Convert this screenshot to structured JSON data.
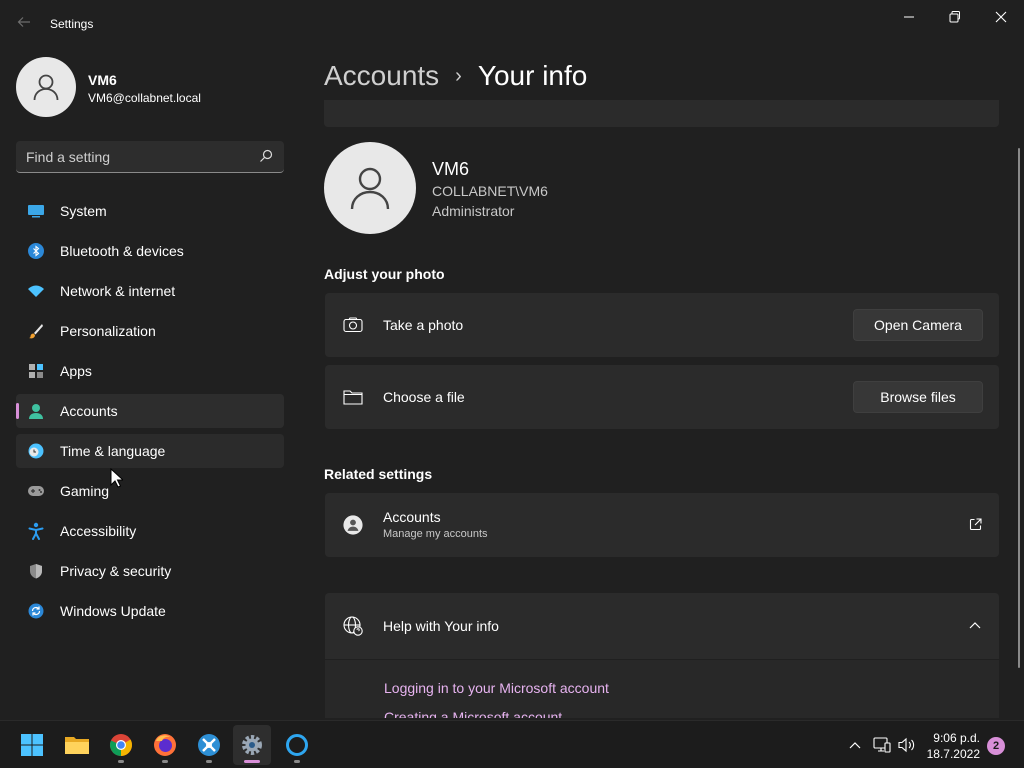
{
  "window": {
    "title": "Settings",
    "accent": "#d88fd8"
  },
  "user": {
    "name": "VM6",
    "email": "VM6@collabnet.local"
  },
  "search": {
    "placeholder": "Find a setting"
  },
  "sidebar": {
    "items": [
      {
        "label": "System",
        "icon": "system-icon"
      },
      {
        "label": "Bluetooth & devices",
        "icon": "bluetooth-icon"
      },
      {
        "label": "Network & internet",
        "icon": "wifi-icon"
      },
      {
        "label": "Personalization",
        "icon": "brush-icon"
      },
      {
        "label": "Apps",
        "icon": "apps-icon"
      },
      {
        "label": "Accounts",
        "icon": "accounts-icon",
        "selected": true
      },
      {
        "label": "Time & language",
        "icon": "time-language-icon"
      },
      {
        "label": "Gaming",
        "icon": "gamepad-icon"
      },
      {
        "label": "Accessibility",
        "icon": "accessibility-icon"
      },
      {
        "label": "Privacy & security",
        "icon": "shield-icon"
      },
      {
        "label": "Windows Update",
        "icon": "update-icon"
      }
    ]
  },
  "breadcrumb": {
    "parent": "Accounts",
    "separator": "›",
    "current": "Your info"
  },
  "profile": {
    "name": "VM6",
    "domain_user": "COLLABNET\\VM6",
    "role": "Administrator"
  },
  "adjust_photo": {
    "heading": "Adjust your photo",
    "take_photo": {
      "label": "Take a photo",
      "button": "Open Camera"
    },
    "choose_file": {
      "label": "Choose a file",
      "button": "Browse files"
    }
  },
  "related": {
    "heading": "Related settings",
    "accounts": {
      "label": "Accounts",
      "sublabel": "Manage my accounts"
    }
  },
  "help": {
    "title": "Help with Your info",
    "links": [
      "Logging in to your Microsoft account",
      "Creating a Microsoft account"
    ]
  },
  "taskbar": {
    "apps": [
      "start-icon",
      "file-explorer-icon",
      "chrome-icon",
      "firefox-icon",
      "app-icon",
      "settings-icon",
      "cortana-icon"
    ],
    "time": "9:06 p.d.",
    "date": "18.7.2022",
    "notifications": "2"
  }
}
